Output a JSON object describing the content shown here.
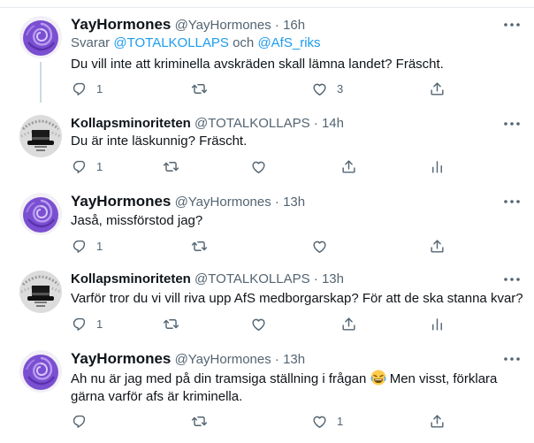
{
  "tweets": [
    {
      "name": "YayHormones",
      "handle": "@YayHormones",
      "time": "16h",
      "reply_prefix": "Svarar",
      "reply_user1": "@TOTALKOLLAPS",
      "reply_and": "och",
      "reply_user2": "@AfS_riks",
      "text": "Du vill inte att kriminella avskräden skall lämna landet? Fräscht.",
      "reply_count": "1",
      "like_count": "3"
    },
    {
      "name": "Kollapsminoriteten",
      "handle": "@TOTALKOLLAPS",
      "time": "14h",
      "text": "Du är inte läskunnig? Fräscht.",
      "reply_count": "1"
    },
    {
      "name": "YayHormones",
      "handle": "@YayHormones",
      "time": "13h",
      "text": "Jaså, missförstod jag?",
      "reply_count": "1"
    },
    {
      "name": "Kollapsminoriteten",
      "handle": "@TOTALKOLLAPS",
      "time": "13h",
      "text": "Varför tror du vi vill riva upp AfS medborgarskap? För att de ska stanna kvar?",
      "reply_count": "1"
    },
    {
      "name": "YayHormones",
      "handle": "@YayHormones",
      "time": "13h",
      "text_before_emoji": "Ah nu är jag med på din tramsiga ställning i frågan",
      "text_after_emoji": " Men visst, förklara",
      "text_line2": "gärna varför afs är kriminella.",
      "like_count": "1"
    }
  ],
  "dot": "·",
  "icons": [
    "rose-avatar",
    "hat-avatar",
    "reply-icon",
    "retweet-icon",
    "like-icon",
    "share-icon",
    "analytics-icon",
    "more-icon",
    "laughing-emoji"
  ],
  "colors": {
    "link": "#1d9bf0",
    "secondary": "#536471",
    "line": "#cfd9de"
  }
}
